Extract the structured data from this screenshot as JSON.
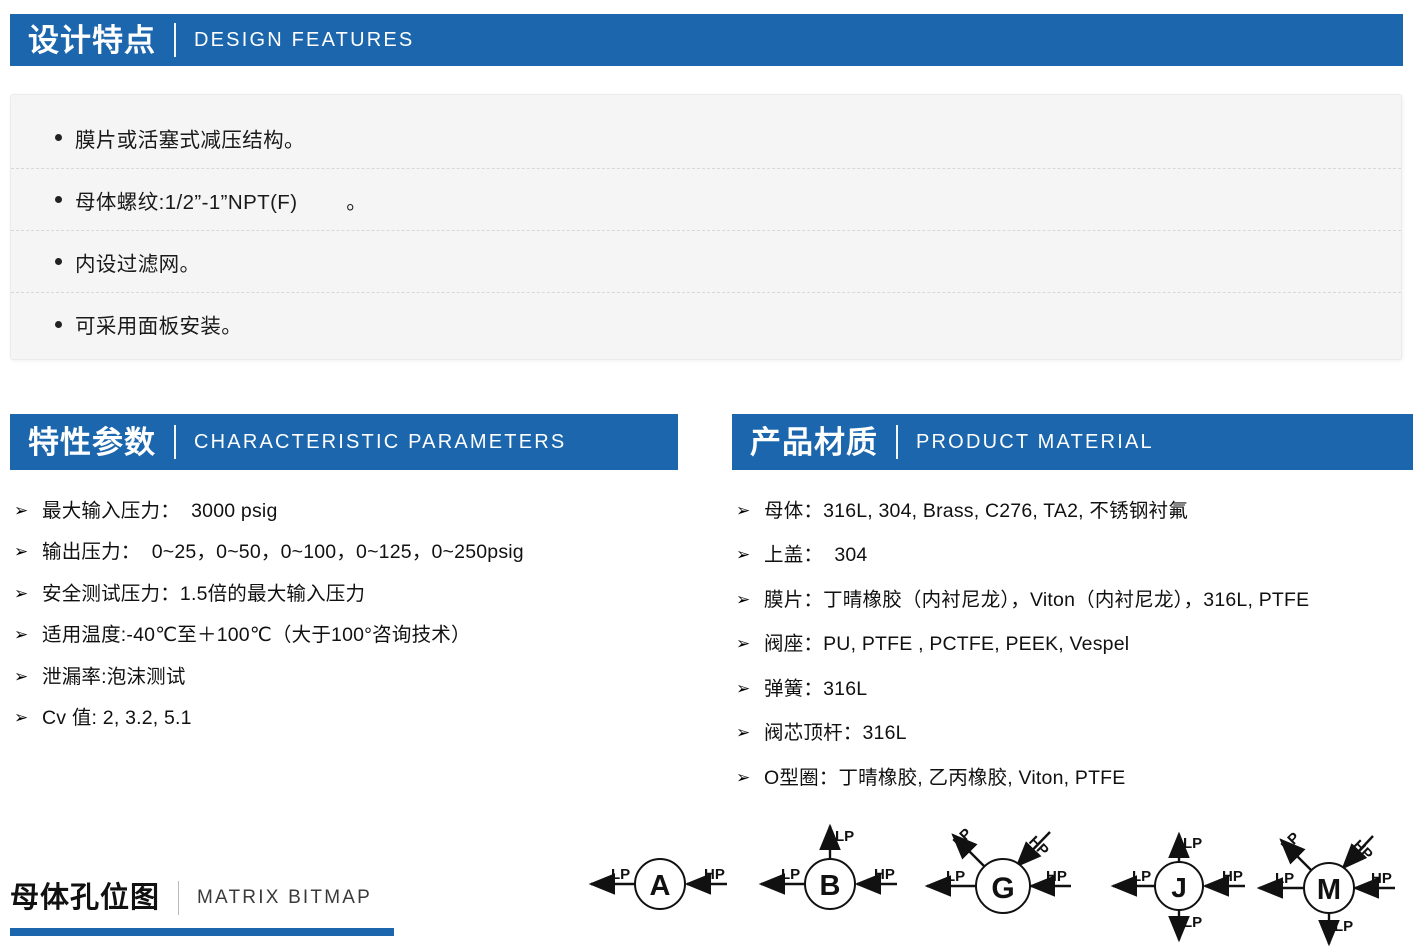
{
  "sections": {
    "design": {
      "cn": "设计特点",
      "en": "DESIGN FEATURES"
    },
    "params": {
      "cn": "特性参数",
      "en": "CHARACTERISTIC PARAMETERS"
    },
    "material": {
      "cn": "产品材质",
      "en": "PRODUCT MATERIAL"
    },
    "matrix": {
      "cn": "母体孔位图",
      "en": "MATRIX BITMAP"
    }
  },
  "design_features": [
    "膜片或活塞式减压结构。",
    "母体螺纹:1/2”-1”NPT(F)        。",
    "内设过滤网。",
    "可采用面板安装。"
  ],
  "characteristic_parameters": [
    "最大输入压力：  3000 psig",
    "输出压力：  0~25，0~50，0~100，0~125，0~250psig",
    "安全测试压力：1.5倍的最大输入压力",
    "适用温度:-40℃至＋100℃（大于100°咨询技术）",
    "泄漏率:泡沫测试",
    "Cv 值: 2, 3.2, 5.1"
  ],
  "product_material": [
    "母体：316L, 304, Brass, C276, TA2, 不锈钢衬氟",
    "上盖：  304",
    "膜片：丁晴橡胶（内衬尼龙），Viton（内衬尼龙），316L, PTFE",
    "阀座：PU, PTFE , PCTFE, PEEK, Vespel",
    "弹簧：316L",
    "阀芯顶杆：316L",
    "O型圈：丁晴橡胶, 乙丙橡胶, Viton, PTFE"
  ],
  "bullet_markers": {
    "dot": "●",
    "arrow": "➢"
  },
  "port_diagrams": [
    {
      "letter": "A",
      "ports": [
        {
          "dir": "left",
          "label": "LP",
          "flow": "out"
        },
        {
          "dir": "right",
          "label": "HP",
          "flow": "in"
        }
      ]
    },
    {
      "letter": "B",
      "ports": [
        {
          "dir": "up",
          "label": "LP",
          "flow": "out"
        },
        {
          "dir": "left",
          "label": "LP",
          "flow": "out"
        },
        {
          "dir": "right",
          "label": "HP",
          "flow": "in"
        }
      ]
    },
    {
      "letter": "G",
      "ports": [
        {
          "dir": "up-left",
          "label": "LP",
          "flow": "out"
        },
        {
          "dir": "up-right",
          "label": "HP",
          "flow": "in"
        },
        {
          "dir": "left",
          "label": "LP",
          "flow": "out"
        },
        {
          "dir": "right",
          "label": "HP",
          "flow": "in"
        }
      ]
    },
    {
      "letter": "J",
      "ports": [
        {
          "dir": "up",
          "label": "LP",
          "flow": "out"
        },
        {
          "dir": "left",
          "label": "LP",
          "flow": "out"
        },
        {
          "dir": "right",
          "label": "HP",
          "flow": "in"
        },
        {
          "dir": "down",
          "label": "LP",
          "flow": "out"
        }
      ]
    },
    {
      "letter": "M",
      "ports": [
        {
          "dir": "up-left",
          "label": "LP",
          "flow": "out"
        },
        {
          "dir": "up-right",
          "label": "HP",
          "flow": "in"
        },
        {
          "dir": "left",
          "label": "LP",
          "flow": "out"
        },
        {
          "dir": "right",
          "label": "HP",
          "flow": "in"
        },
        {
          "dir": "down",
          "label": "LP",
          "flow": "out"
        }
      ]
    }
  ],
  "colors": {
    "brand_blue": "#1b66ad",
    "card_bg": "#f5f5f5",
    "divider": "#d8d8d8"
  }
}
